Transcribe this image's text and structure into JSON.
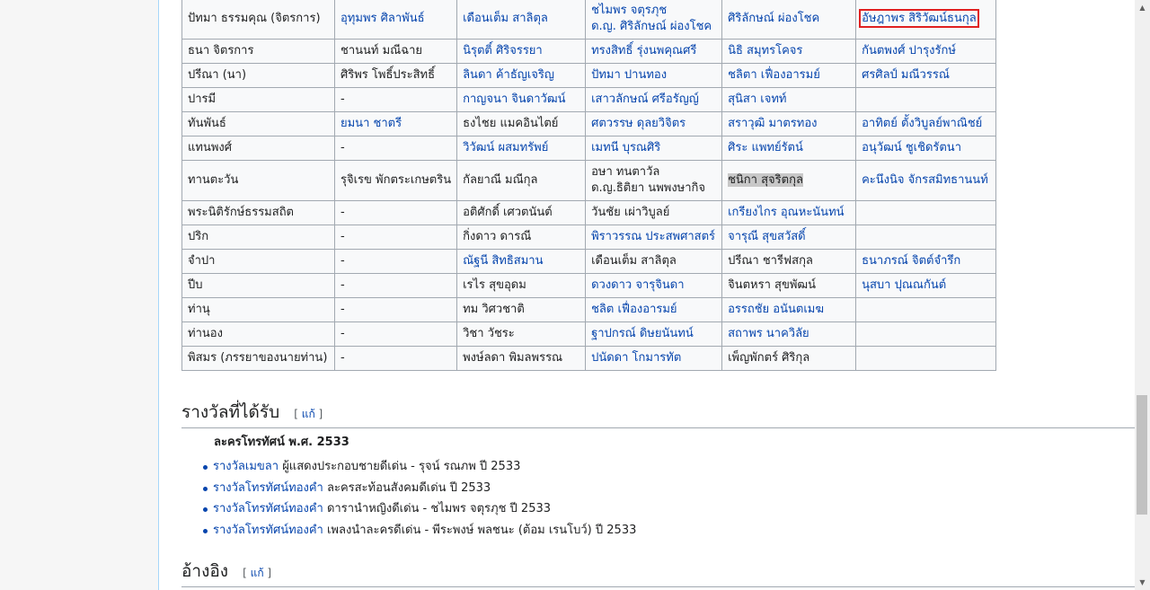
{
  "table": {
    "rows": [
      {
        "cells": [
          {
            "text": "ปัทมา ธรรมคุณ (จิตรการ)",
            "link": false
          },
          {
            "text": "อุทุมพร ศิลาพันธ์",
            "link": true
          },
          {
            "text": "เดือนเต็ม สาลิตุล",
            "link": true
          },
          {
            "text": "ชไมพร จตุรภุช",
            "text2": "ด.ญ. ศิริลักษณ์ ผ่องโชค",
            "link": true
          },
          {
            "text": "ศิริลักษณ์ ผ่องโชค",
            "link": true
          },
          {
            "text": "อัษฎาพร สิริวัฒน์ธนกุล",
            "link": true,
            "boxed": true
          }
        ],
        "tall": true
      },
      {
        "cells": [
          {
            "text": "ธนา จิตรการ",
            "link": false
          },
          {
            "text": "ชานนท์ มณีฉาย",
            "link": false
          },
          {
            "text": "นิรุตติ์ ศิริจรรยา",
            "link": true
          },
          {
            "text": "ทรงสิทธิ์ รุ่งนพคุณศรี",
            "link": true
          },
          {
            "text": "นิธิ สมุทรโคจร",
            "link": true
          },
          {
            "text": "กันตพงศ์ ปารุงรักษ์",
            "link": true
          }
        ]
      },
      {
        "cells": [
          {
            "text": "ปรีณา (นา)",
            "link": false
          },
          {
            "text": "ศิริพร โพธิ์ประสิทธิ์",
            "link": false
          },
          {
            "text": "ลินดา ค้าธัญเจริญ",
            "link": true
          },
          {
            "text": "ปัทมา ปานทอง",
            "link": true
          },
          {
            "text": "ชลิตา เฟื่องอารมย์",
            "link": true
          },
          {
            "text": "ศรศิลป์ มณีวรรณ์",
            "link": true
          }
        ]
      },
      {
        "cells": [
          {
            "text": "ปารมี",
            "link": false
          },
          {
            "text": "-",
            "link": false
          },
          {
            "text": "กาญจนา จินดาวัฒน์",
            "link": true
          },
          {
            "text": "เสาวลักษณ์ ศรีอรัญญ์",
            "link": true
          },
          {
            "text": "สุนิสา เจทท์",
            "link": true
          },
          {
            "text": "",
            "link": false
          }
        ]
      },
      {
        "cells": [
          {
            "text": "ทันพันธ์",
            "link": false
          },
          {
            "text": "ยมนา ชาตรี",
            "link": true
          },
          {
            "text": "ธงไชย แมคอินไตย์",
            "link": false
          },
          {
            "text": "ศตวรรษ ดุลยวิจิตร",
            "link": true
          },
          {
            "text": "สราวุฒิ มาตรทอง",
            "link": true
          },
          {
            "text": "อาทิตย์ ตั้งวิบูลย์พาณิชย์",
            "link": true
          }
        ]
      },
      {
        "cells": [
          {
            "text": "แทนพงศ์",
            "link": false
          },
          {
            "text": "-",
            "link": false
          },
          {
            "text": "วิวัฒน์ ผสมทรัพย์",
            "link": true
          },
          {
            "text": "เมทนี บุรณศิริ",
            "link": true
          },
          {
            "text": "ศิระ แพทย์รัตน์",
            "link": true
          },
          {
            "text": "อนุวัฒน์ ชูเชิดรัตนา",
            "link": true
          }
        ]
      },
      {
        "cells": [
          {
            "text": "ทานตะวัน",
            "link": false
          },
          {
            "text": "รุจิเรข พักตระเกษตริน",
            "link": false
          },
          {
            "text": "กัลยาณี มณีกุล",
            "link": false
          },
          {
            "text": "อษา ทนตาวัล",
            "text2": "ด.ญ.ธิติยา นพพงษากิจ",
            "link": false
          },
          {
            "text": "ชนิกา สุจริตกุล",
            "link": false,
            "highlight": true
          },
          {
            "text": "คะนึงนิจ จักรสมิทธานนท์",
            "link": true
          }
        ],
        "tall": true
      },
      {
        "cells": [
          {
            "text": "พระนิติรักษ์ธรรมสถิต",
            "link": false
          },
          {
            "text": "-",
            "link": false
          },
          {
            "text": "อติศักดิ์ เศวตนันต์",
            "link": false
          },
          {
            "text": "วันชัย เผ่าวิบูลย์",
            "link": false
          },
          {
            "text": "เกรียงไกร อุณหะนันทน์",
            "link": true
          },
          {
            "text": "",
            "link": false
          }
        ]
      },
      {
        "cells": [
          {
            "text": "ปริก",
            "link": false
          },
          {
            "text": "-",
            "link": false
          },
          {
            "text": "กิ่งดาว ดารณี",
            "link": false
          },
          {
            "text": "พิราวรรณ ประสพศาสตร์",
            "link": true
          },
          {
            "text": "จารุณี สุขสวัสดิ์",
            "link": true
          },
          {
            "text": "",
            "link": false
          }
        ]
      },
      {
        "cells": [
          {
            "text": "จำปา",
            "link": false
          },
          {
            "text": "-",
            "link": false
          },
          {
            "text": "ณัฐนี สิทธิสมาน",
            "link": true
          },
          {
            "text": "เดือนเต็ม สาลิตุล",
            "link": false
          },
          {
            "text": "ปรีณา ชารีฟสกุล",
            "link": false
          },
          {
            "text": "ธนาภรณ์ จิตต์จำรึก",
            "link": true
          }
        ]
      },
      {
        "cells": [
          {
            "text": "ปีบ",
            "link": false
          },
          {
            "text": "-",
            "link": false
          },
          {
            "text": "เรไร สุขอุดม",
            "link": false
          },
          {
            "text": "ดวงดาว จารุจินดา",
            "link": true
          },
          {
            "text": "จินตหรา สุขพัฒน์",
            "link": false
          },
          {
            "text": "นุสบา ปุณณกันต์",
            "link": true
          }
        ]
      },
      {
        "cells": [
          {
            "text": "ท่านุ",
            "link": false
          },
          {
            "text": "-",
            "link": false
          },
          {
            "text": "ทม วิศวชาติ",
            "link": false
          },
          {
            "text": "ชลิต เฟื่องอารมย์",
            "link": true
          },
          {
            "text": "อรรถชัย อนันตเมฆ",
            "link": true
          },
          {
            "text": "",
            "link": false
          }
        ]
      },
      {
        "cells": [
          {
            "text": "ท่านอง",
            "link": false
          },
          {
            "text": "-",
            "link": false
          },
          {
            "text": "วิชา วัชระ",
            "link": false
          },
          {
            "text": "ฐาปกรณ์ ดิษยนันทน์",
            "link": true
          },
          {
            "text": "สถาพร นาควิลัย",
            "link": true
          },
          {
            "text": "",
            "link": false
          }
        ]
      },
      {
        "cells": [
          {
            "text": "พิสมร (ภรรยาของนายท่าน)",
            "link": false
          },
          {
            "text": "-",
            "link": false
          },
          {
            "text": "พงษ์ลดา พิมลพรรณ",
            "link": false
          },
          {
            "text": "ปนัดดา โกมารทัต",
            "link": true
          },
          {
            "text": "เพ็ญพักตร์ ศิริกุล",
            "link": false
          },
          {
            "text": "",
            "link": false
          }
        ]
      }
    ]
  },
  "awards": {
    "heading": "รางวัลที่ได้รับ",
    "edit_label": "แก้",
    "subheading": "ละครโทรทัศน์ พ.ศ. 2533",
    "items": [
      {
        "link": "รางวัลเมขลา",
        "rest": " ผู้แสดงประกอบชายดีเด่น - รุจน์ รณภพ ปี 2533"
      },
      {
        "link": "รางวัลโทรทัศน์ทองคำ",
        "rest": " ละครสะท้อนสังคมดีเด่น ปี 2533"
      },
      {
        "link": "รางวัลโทรทัศน์ทองคำ",
        "rest": " ดารานำหญิงดีเด่น - ชไมพร จตุรภุช ปี 2533"
      },
      {
        "link": "รางวัลโทรทัศน์ทองคำ",
        "rest": " เพลงนำละครดีเด่น - พีระพงษ์ พลชนะ (ต้อม เรนโบว์) ปี 2533"
      }
    ]
  },
  "references": {
    "heading": "อ้างอิง",
    "edit_label": "แก้"
  },
  "colors": {
    "link": "#0645ad",
    "highlight_box": "#e02020",
    "selection": "#c8c8c8"
  }
}
